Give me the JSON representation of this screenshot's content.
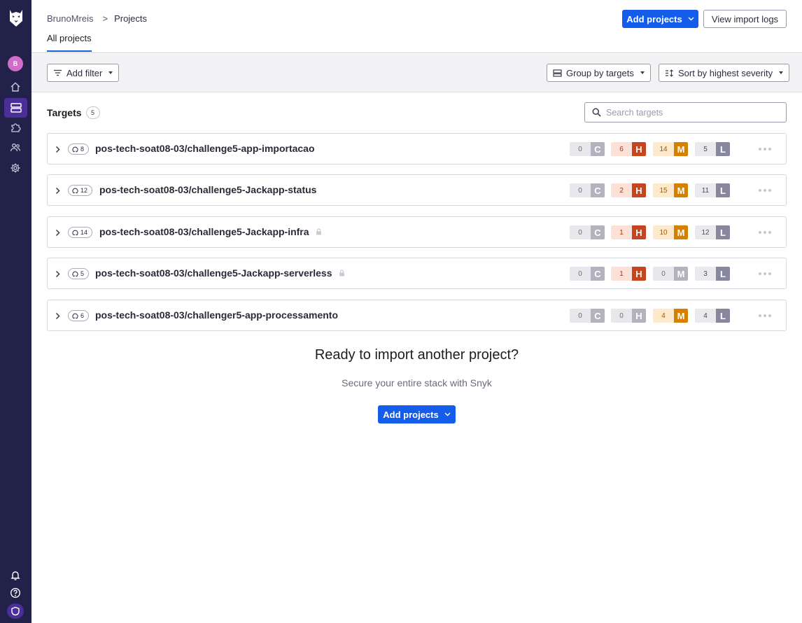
{
  "sidebar": {
    "avatar_initial": "B",
    "icons": [
      "snyk-logo-icon",
      "home-icon",
      "projects-icon",
      "integrations-icon",
      "members-icon",
      "settings-icon",
      "bell-icon",
      "help-icon",
      "shield-icon"
    ]
  },
  "header": {
    "breadcrumb_org": "BrunoMreis",
    "breadcrumb_sep": ">",
    "breadcrumb_page": "Projects",
    "tab_label": "All projects",
    "add_projects_label": "Add projects",
    "view_logs_label": "View import logs"
  },
  "filters": {
    "add_filter_label": "Add filter",
    "group_by_label": "Group by targets",
    "sort_label": "Sort by highest severity"
  },
  "targets": {
    "title": "Targets",
    "count": "5",
    "search_placeholder": "Search targets",
    "rows": [
      {
        "project_count": "8",
        "name": "pos-tech-soat08-03/challenge5-app-importacao",
        "private": false,
        "critical": "0",
        "high": "6",
        "medium": "14",
        "low": "5",
        "high_active": true,
        "medium_active": true
      },
      {
        "project_count": "12",
        "name": "pos-tech-soat08-03/challenge5-Jackapp-status",
        "private": false,
        "critical": "0",
        "high": "2",
        "medium": "15",
        "low": "11",
        "high_active": true,
        "medium_active": true
      },
      {
        "project_count": "14",
        "name": "pos-tech-soat08-03/challenge5-Jackapp-infra",
        "private": true,
        "critical": "0",
        "high": "1",
        "medium": "10",
        "low": "12",
        "high_active": true,
        "medium_active": true
      },
      {
        "project_count": "5",
        "name": "pos-tech-soat08-03/challenge5-Jackapp-serverless",
        "private": true,
        "critical": "0",
        "high": "1",
        "medium": "0",
        "low": "3",
        "high_active": true,
        "medium_active": false
      },
      {
        "project_count": "6",
        "name": "pos-tech-soat08-03/challenger5-app-processamento",
        "private": false,
        "critical": "0",
        "high": "0",
        "medium": "4",
        "low": "4",
        "high_active": false,
        "medium_active": true
      }
    ]
  },
  "severity_letters": {
    "critical": "C",
    "high": "H",
    "medium": "M",
    "low": "L"
  },
  "empty_prompt": {
    "title": "Ready to import another project?",
    "subtitle": "Secure your entire stack with Snyk",
    "button_label": "Add projects"
  },
  "colors": {
    "sidebar": "#21214a",
    "primary": "#145deb",
    "high": "#c6451f",
    "medium": "#d68000",
    "low": "#88879e",
    "inactive": "#b3b2bd"
  }
}
